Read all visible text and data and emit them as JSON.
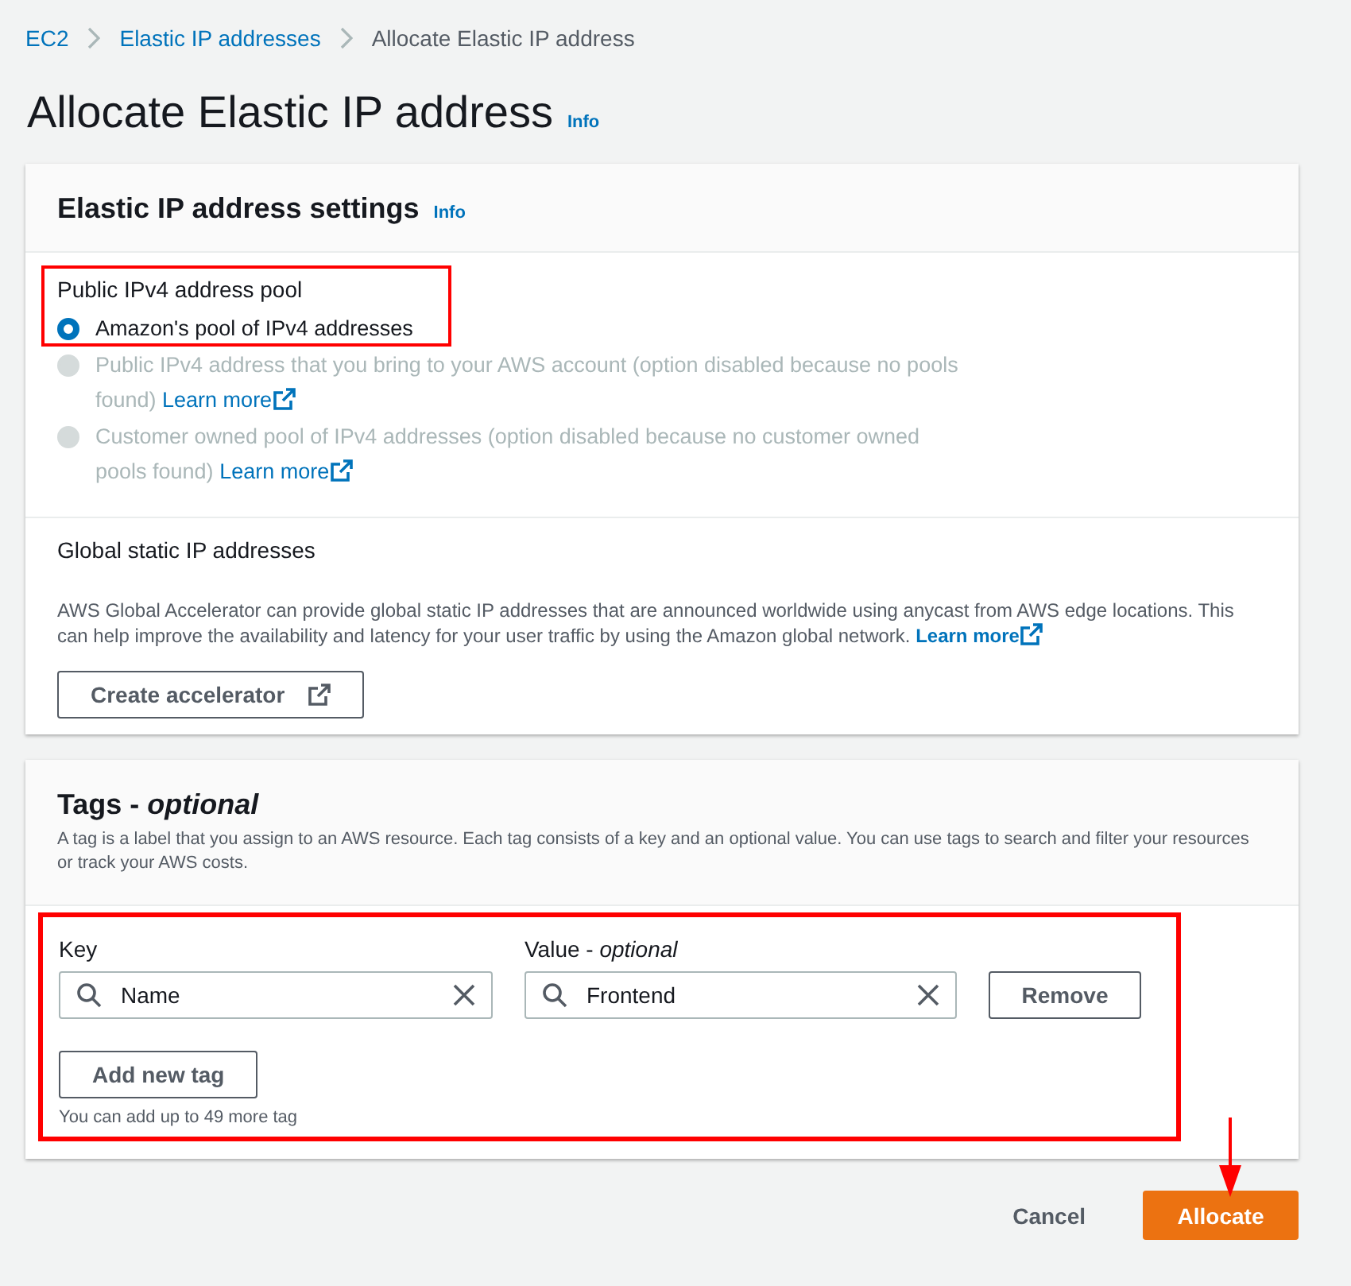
{
  "breadcrumb": [
    {
      "label": "EC2",
      "link": true
    },
    {
      "label": "Elastic IP addresses",
      "link": true
    },
    {
      "label": "Allocate Elastic IP address",
      "link": false
    }
  ],
  "title": "Allocate Elastic IP address",
  "title_info": "Info",
  "settings": {
    "title": "Elastic IP address settings",
    "info": "Info",
    "pool_label": "Public IPv4 address pool",
    "options": [
      {
        "label": "Amazon's pool of IPv4 addresses",
        "selected": true,
        "disabled": false
      },
      {
        "label": "Public IPv4 address that you bring to your AWS account (option disabled because no pools found)",
        "link": "Learn more",
        "selected": false,
        "disabled": true
      },
      {
        "label": "Customer owned pool of IPv4 addresses (option disabled because no customer owned pools found)",
        "link": "Learn more",
        "selected": false,
        "disabled": true
      }
    ],
    "global_title": "Global static IP addresses",
    "global_text": "AWS Global Accelerator can provide global static IP addresses that are announced worldwide using anycast from AWS edge locations. This can help improve the availability and latency for your user traffic by using the Amazon global network.",
    "global_link": "Learn more",
    "create_button": "Create accelerator"
  },
  "tags": {
    "title": "Tags - *optional*",
    "description": "A tag is a label that you assign to an AWS resource. Each tag consists of a key and an optional value. You can use tags to search and filter your resources or track your AWS costs.",
    "key_label": "Key",
    "value_label": "Value - *optional*",
    "rows": [
      {
        "key": "Name",
        "value": "Frontend",
        "remove": "Remove"
      }
    ],
    "add_button": "Add new tag",
    "hint": "You can add up to 49 more tag"
  },
  "buttons": {
    "cancel": "Cancel",
    "allocate": "Allocate"
  }
}
